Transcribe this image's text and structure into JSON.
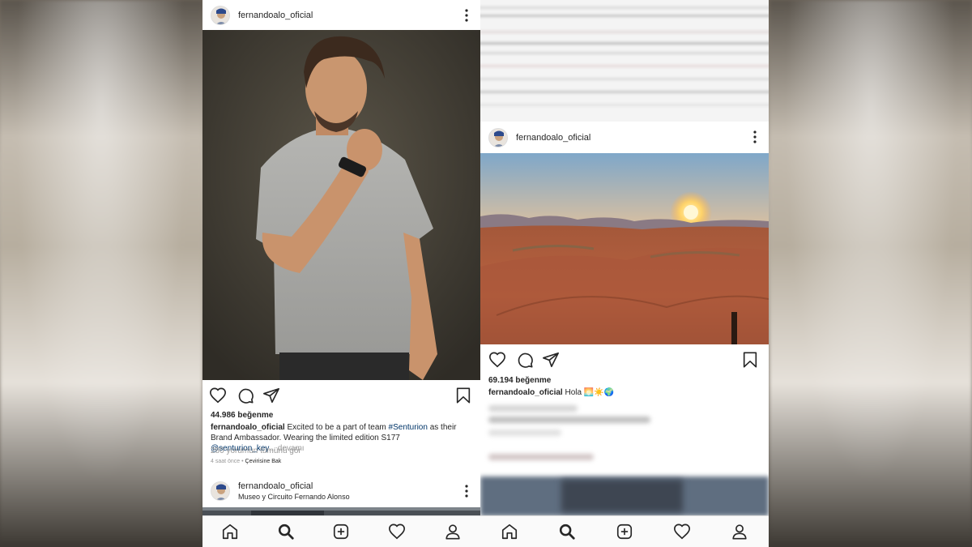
{
  "left_post": {
    "username": "fernandoalo_oficial",
    "likes": "44.986 beğenme",
    "caption_user": "fernandoalo_oficial",
    "caption_text_1": " Excited to be a part of team ",
    "caption_hashtag": "#Senturion",
    "caption_text_2": " as their Brand Ambassador. Wearing the limited edition S177 ",
    "caption_mention": "@senturion_key",
    "caption_more": "... devamı",
    "comments_link": "280 yorumun tümünü gör",
    "time_ago": "4 saat önce",
    "time_separator": " • ",
    "translate": "Çevirisine Bak"
  },
  "left_next_post": {
    "username": "fernandoalo_oficial",
    "location": "Museo y Circuito Fernando Alonso"
  },
  "right_post": {
    "username": "fernandoalo_oficial",
    "likes": "69.194 beğenme",
    "caption_user": "fernandoalo_oficial",
    "caption_text": " Hola ",
    "caption_emoji": "🌅☀️🌍"
  },
  "bottom_nav": {
    "items": [
      "home-icon",
      "search-icon",
      "new-post-icon",
      "activity-heart-icon",
      "profile-icon"
    ],
    "active": "search-icon"
  },
  "colors": {
    "link": "#003569",
    "muted": "#999999",
    "text": "#262626",
    "border": "#dbdbdb"
  }
}
